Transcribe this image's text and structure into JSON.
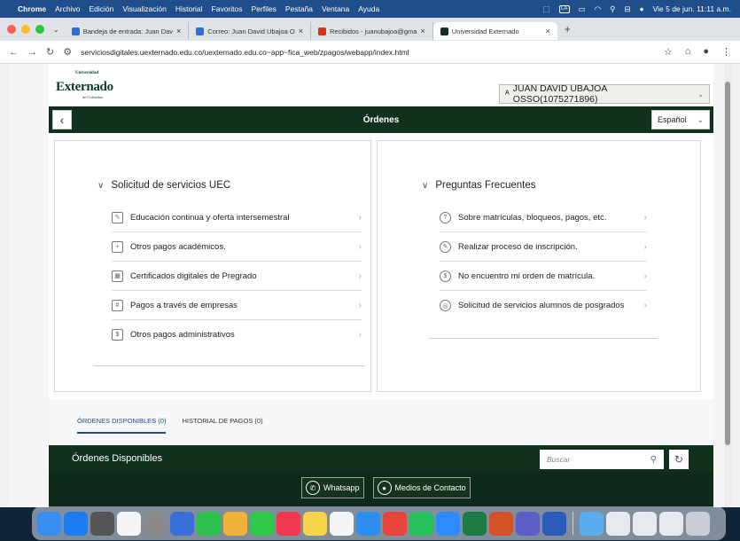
{
  "menubar": {
    "app": "Chrome",
    "items": [
      "Archivo",
      "Edición",
      "Visualización",
      "Historial",
      "Favoritos",
      "Perfiles",
      "Pestaña",
      "Ventana",
      "Ayuda"
    ],
    "datetime": "Vie 5 de jun.  11:11 a.m.",
    "lang_badge": "LA"
  },
  "browser": {
    "tabs": [
      {
        "label": "Bandeja de entrada: Juan Dav",
        "color": "#2f6fd1"
      },
      {
        "label": "Correo: Juan David Ubajoa O",
        "color": "#2f6fd1"
      },
      {
        "label": "Recibidos - juanubajoa@gma",
        "color": "#d93025"
      },
      {
        "label": "Universidad Externado",
        "color": "#11311f"
      }
    ],
    "url": "serviciosdigitales.uexternado.edu.co/uexternado.edu.co~app~fica_web/zpagos/webapp/index.html"
  },
  "site": {
    "logo_small": "Universidad",
    "logo_main": "Externado",
    "logo_sub": "de Colombia",
    "user": "JUAN DAVID UBAJOA OSSO(1075271896)",
    "title": "Órdenes",
    "language": "Español"
  },
  "left_panel": {
    "heading": "Solicitud de servicios UEC",
    "items": [
      {
        "label": "Educación continua y oferta intersemestral",
        "icon": "education-icon"
      },
      {
        "label": "Otros pagos académicos.",
        "icon": "document-plus-icon"
      },
      {
        "label": "Certificados digitales de Pregrado",
        "icon": "certificate-icon"
      },
      {
        "label": "Pagos a través de empresas",
        "icon": "calculator-icon"
      },
      {
        "label": "Otros pagos administrativos",
        "icon": "receipt-icon"
      }
    ]
  },
  "right_panel": {
    "heading": "Preguntas Frecuentes",
    "items": [
      {
        "label": "Sobre matrículas, bloqueos, pagos, etc.",
        "icon": "chat-icon"
      },
      {
        "label": "Realizar proceso de inscripción.",
        "icon": "edit-document-icon"
      },
      {
        "label": "No encuentro mi orden de matrícula.",
        "icon": "file-search-icon"
      },
      {
        "label": "Solicitud de servicios alumnos de posgrados",
        "icon": "support-icon"
      }
    ]
  },
  "tabs": {
    "available": "ÓRDENES DISPONIBLES (0)",
    "history": "HISTORIAL DE PAGOS (0)"
  },
  "orders": {
    "title": "Órdenes Disponibles",
    "search_placeholder": "Buscar"
  },
  "contact": {
    "whatsapp": "Whatsapp",
    "medios": "Medios de Contacto"
  },
  "dock": {
    "apps": [
      {
        "name": "finder",
        "color": "#3a8ef0"
      },
      {
        "name": "app-store",
        "color": "#1d7cf2"
      },
      {
        "name": "calculator",
        "color": "#555"
      },
      {
        "name": "calendar",
        "color": "#f4f4f4"
      },
      {
        "name": "settings",
        "color": "#8a8a8a"
      },
      {
        "name": "facetime-dark",
        "color": "#3b6fd8"
      },
      {
        "name": "facetime",
        "color": "#2bbf4b"
      },
      {
        "name": "photos",
        "color": "#f1b23a"
      },
      {
        "name": "messages",
        "color": "#31c94a"
      },
      {
        "name": "music",
        "color": "#f0394f"
      },
      {
        "name": "notes",
        "color": "#f7d54a"
      },
      {
        "name": "reminders",
        "color": "#f4f4f4"
      },
      {
        "name": "safari",
        "color": "#2c8ff0"
      },
      {
        "name": "chrome",
        "color": "#e8453c"
      },
      {
        "name": "whatsapp",
        "color": "#25c05a"
      },
      {
        "name": "zoom",
        "color": "#2d8cff"
      },
      {
        "name": "excel",
        "color": "#1e7a45"
      },
      {
        "name": "powerpoint",
        "color": "#d4522a"
      },
      {
        "name": "teams",
        "color": "#5b5fc7"
      },
      {
        "name": "word",
        "color": "#2b5cb8"
      }
    ],
    "extras": [
      {
        "name": "downloads-folder",
        "color": "#5aaef0"
      },
      {
        "name": "document-1",
        "color": "#e6eaee"
      },
      {
        "name": "document-2",
        "color": "#e6eaee"
      },
      {
        "name": "document-3",
        "color": "#e6eaee"
      },
      {
        "name": "trash",
        "color": "#c9ced4"
      }
    ]
  }
}
